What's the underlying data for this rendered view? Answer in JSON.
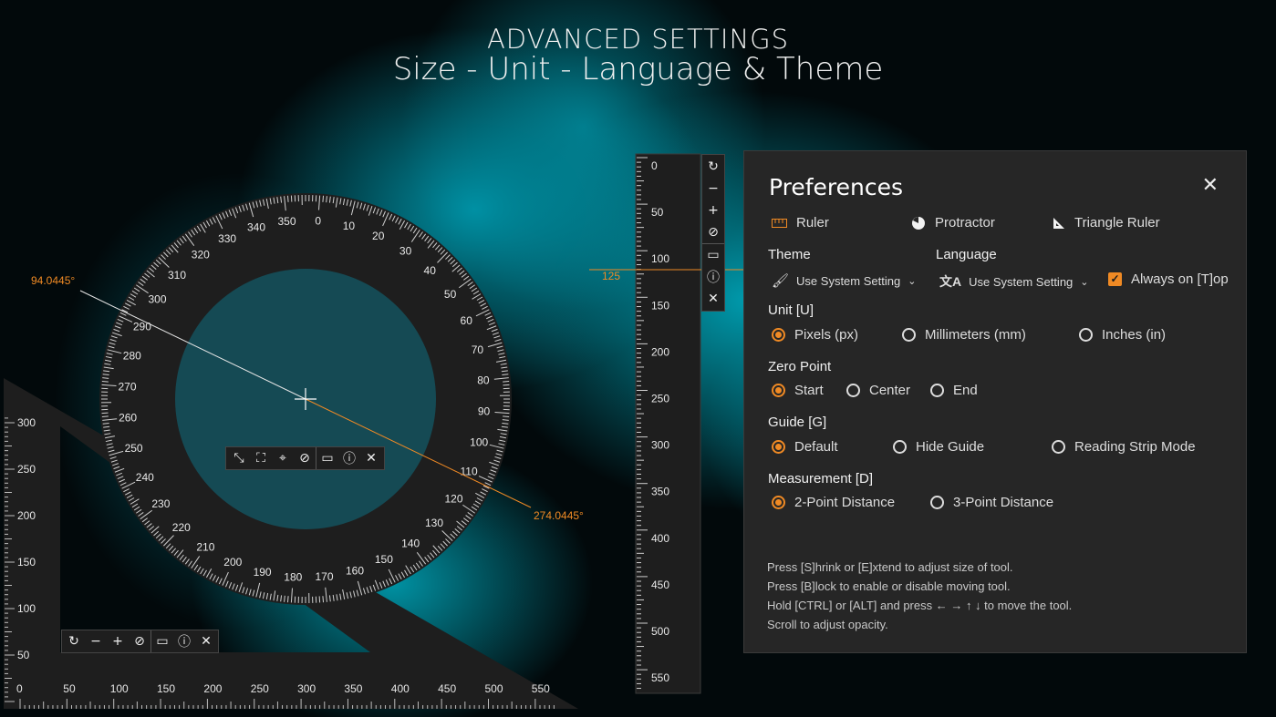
{
  "header": {
    "line1": "ADVANCED SETTINGS",
    "line2": "Size - Unit - Language & Theme"
  },
  "protractor": {
    "angle_a": "94.0445°",
    "angle_b": "274.0445°",
    "toolbar_icons": [
      "shrink-icon",
      "extend-icon",
      "crosshair-icon",
      "block-icon",
      "ruler-icon",
      "info-icon",
      "close-icon"
    ]
  },
  "triangle_ruler": {
    "y_labels": [
      "300",
      "250",
      "200",
      "150",
      "100",
      "50"
    ],
    "x_labels": [
      "0",
      "50",
      "100",
      "150",
      "200",
      "250",
      "300",
      "350",
      "400",
      "450",
      "500",
      "550"
    ],
    "toolbar_icons": [
      "rotate-icon",
      "minus-icon",
      "plus-icon",
      "block-icon",
      "ruler-icon",
      "info-icon",
      "close-icon"
    ]
  },
  "vertical_ruler": {
    "labels": [
      "0",
      "50",
      "100",
      "150",
      "200",
      "250",
      "300",
      "350",
      "400",
      "450",
      "500",
      "550"
    ],
    "guide_value": "125",
    "toolbar_icons": [
      "rotate-icon",
      "minus-icon",
      "plus-icon",
      "block-icon",
      "ruler-icon",
      "info-icon",
      "close-icon"
    ]
  },
  "preferences": {
    "title": "Preferences",
    "close": "✕",
    "tools": [
      {
        "label": "Ruler",
        "icon": "ruler-icon"
      },
      {
        "label": "Protractor",
        "icon": "protractor-icon"
      },
      {
        "label": "Triangle Ruler",
        "icon": "triangle-ruler-icon"
      }
    ],
    "theme": {
      "label": "Theme",
      "value": "Use System Setting"
    },
    "language": {
      "label": "Language",
      "value": "Use System Setting"
    },
    "always_on_top": {
      "label": "Always on [T]op",
      "checked": true
    },
    "unit": {
      "label": "Unit [U]",
      "options": [
        "Pixels (px)",
        "Millimeters (mm)",
        "Inches (in)"
      ],
      "selected": 0
    },
    "zero_point": {
      "label": "Zero Point",
      "options": [
        "Start",
        "Center",
        "End"
      ],
      "selected": 0
    },
    "guide": {
      "label": "Guide [G]",
      "options": [
        "Default",
        "Hide Guide",
        "Reading Strip Mode"
      ],
      "selected": 0
    },
    "measurement": {
      "label": "Measurement [D]",
      "options": [
        "2-Point Distance",
        "3-Point Distance"
      ],
      "selected": 0
    },
    "help": [
      "Press [S]hrink or [E]xtend to adjust size of tool.",
      "Press [B]lock to enable or disable moving tool.",
      "Hold [CTRL] or [ALT] and press ← → ↑ ↓ to move the tool.",
      "Scroll to adjust opacity."
    ]
  },
  "colors": {
    "accent": "#f08a24",
    "panel": "#262626",
    "tool": "#1e1e1e"
  }
}
